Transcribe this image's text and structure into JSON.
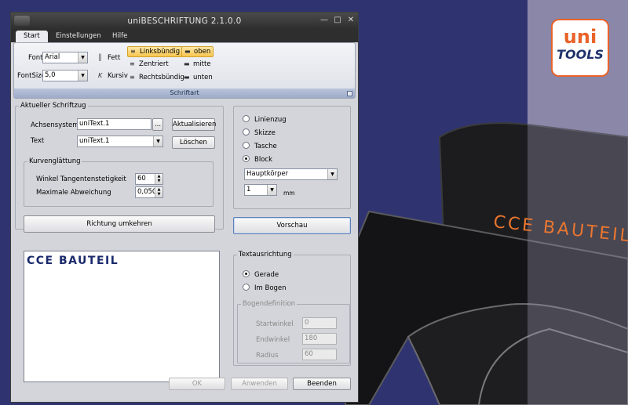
{
  "window": {
    "title": "uniBESCHRIFTUNG 2.1.0.0"
  },
  "tabs": [
    {
      "label": "Start",
      "active": true
    },
    {
      "label": "Einstellungen",
      "active": false
    },
    {
      "label": "Hilfe",
      "active": false
    }
  ],
  "ribbon": {
    "group_label": "Schriftart",
    "font_label": "Font",
    "font_value": "Arial",
    "fontsize_label": "FontSize",
    "fontsize_value": "5,0",
    "bold_label": "Fett",
    "italic_label": "Kursiv",
    "align_left": "Linksbündig",
    "align_center": "Zentriert",
    "align_right": "Rechtsbündig",
    "valign_top": "oben",
    "valign_middle": "mitte",
    "valign_bottom": "unten",
    "selected_align": "Linksbündig",
    "selected_valign": "oben"
  },
  "current": {
    "group_title": "Aktueller Schriftzug",
    "axis_label": "Achsensystem",
    "axis_value": "uniText.1",
    "browse_label": "...",
    "update_button": "Aktualisieren",
    "text_label": "Text",
    "text_value": "uniText.1",
    "delete_button": "Löschen"
  },
  "smoothing": {
    "group_title": "Kurvenglättung",
    "tangent_label": "Winkel Tangentenstetigkeit",
    "tangent_value": "60",
    "deviation_label": "Maximale Abweichung",
    "deviation_value": "0,050"
  },
  "reverse_button": "Richtung umkehren",
  "preview_text": "CCE  BAUTEIL",
  "mode": {
    "options": [
      "Linienzug",
      "Skizze",
      "Tasche",
      "Block"
    ],
    "selected": "Block",
    "body_value": "Hauptkörper",
    "depth_value": "1",
    "depth_unit": "mm"
  },
  "preview_button": "Vorschau",
  "alignment": {
    "group_title": "Textausrichtung",
    "options": [
      "Gerade",
      "Im Bogen"
    ],
    "selected": "Gerade"
  },
  "arc": {
    "group_title": "Bogendefinition",
    "start_label": "Startwinkel",
    "start_value": "0",
    "end_label": "Endwinkel",
    "end_value": "180",
    "radius_label": "Radius",
    "radius_value": "60"
  },
  "footer": {
    "ok": "OK",
    "apply": "Anwenden",
    "close": "Beenden"
  },
  "background": {
    "part_text": "CCE  BAUTEIL",
    "logo_top": "uni",
    "logo_bottom": "TOOLS"
  },
  "colors": {
    "background": "#2f3470",
    "part_text": "#e9762f",
    "logo_accent": "#e9632a",
    "preview_text": "#1a2a6c",
    "ribbon_selected": "#f8c64e"
  }
}
